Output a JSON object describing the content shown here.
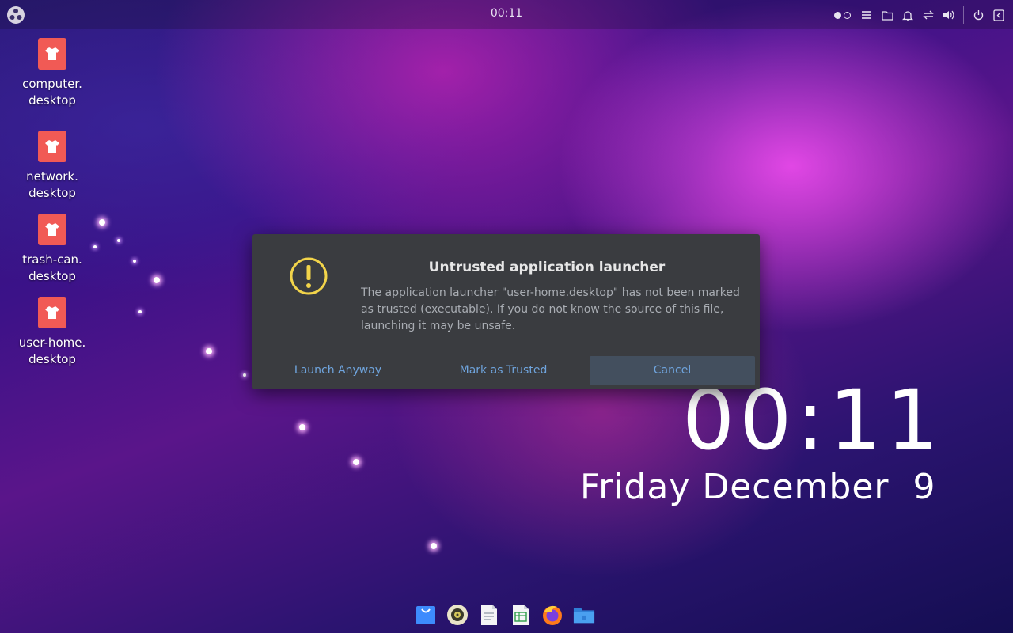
{
  "top_panel": {
    "clock": "00:11",
    "launcher_icon": "launcher-icon",
    "tray_icons": [
      "workspace-indicator",
      "menu-icon",
      "files-icon",
      "bell-icon",
      "network-icon",
      "volume-icon",
      "power-icon",
      "sidebar-icon"
    ]
  },
  "desktop_icons": [
    {
      "line1": "computer.",
      "line2": "desktop"
    },
    {
      "line1": "network.",
      "line2": "desktop"
    },
    {
      "line1": "trash-can.",
      "line2": "desktop"
    },
    {
      "line1": "user-home.",
      "line2": "desktop"
    }
  ],
  "dialog": {
    "title": "Untrusted application launcher",
    "message": "The application launcher \"user-home.desktop\" has not been marked as trusted (executable). If you do not know the source of this file, launching it may be unsafe.",
    "buttons": {
      "launch": "Launch Anyway",
      "trust": "Mark as Trusted",
      "cancel": "Cancel"
    }
  },
  "desktop_clock": {
    "time": "00:11",
    "date": "Friday December  9"
  },
  "dock": {
    "apps": [
      "software-store-icon",
      "music-player-icon",
      "text-editor-icon",
      "spreadsheet-icon",
      "firefox-icon",
      "file-manager-icon"
    ]
  },
  "colors": {
    "desktop_icon_tile": "#f15a55",
    "dialog_bg": "#3a3c40",
    "link_blue": "#6fa4dd",
    "warning_yellow": "#f2d44a"
  }
}
